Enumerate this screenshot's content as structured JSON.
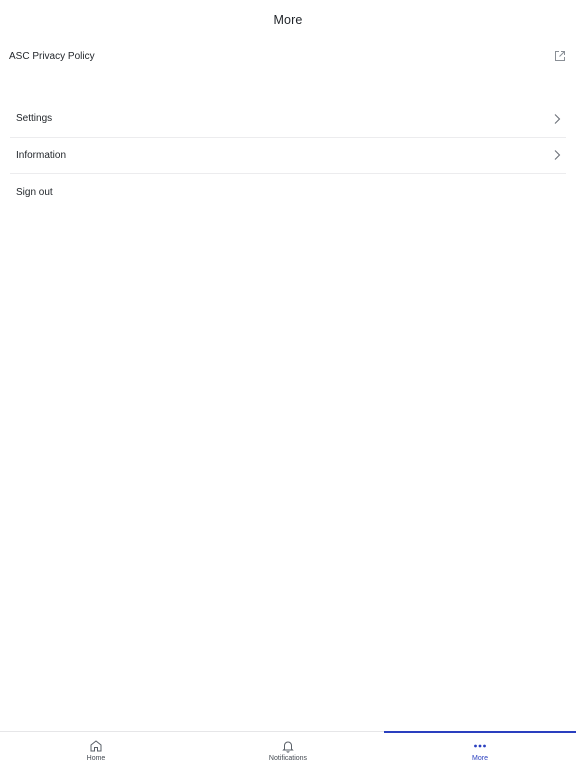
{
  "header": {
    "title": "More"
  },
  "privacy_link": {
    "label": "ASC Privacy Policy",
    "icon": "external-link-icon"
  },
  "menu": {
    "items": [
      {
        "label": "Settings",
        "icon": "chevron-right-icon"
      },
      {
        "label": "Information",
        "icon": "chevron-right-icon"
      },
      {
        "label": "Sign out"
      }
    ]
  },
  "tabbar": {
    "tabs": [
      {
        "label": "Home",
        "icon": "home-icon",
        "active": false
      },
      {
        "label": "Notifications",
        "icon": "bell-icon",
        "active": false
      },
      {
        "label": "More",
        "icon": "more-dots-icon",
        "active": true
      }
    ]
  },
  "colors": {
    "accent": "#2a3fbf",
    "text": "#1f2328",
    "divider": "#ececee"
  }
}
